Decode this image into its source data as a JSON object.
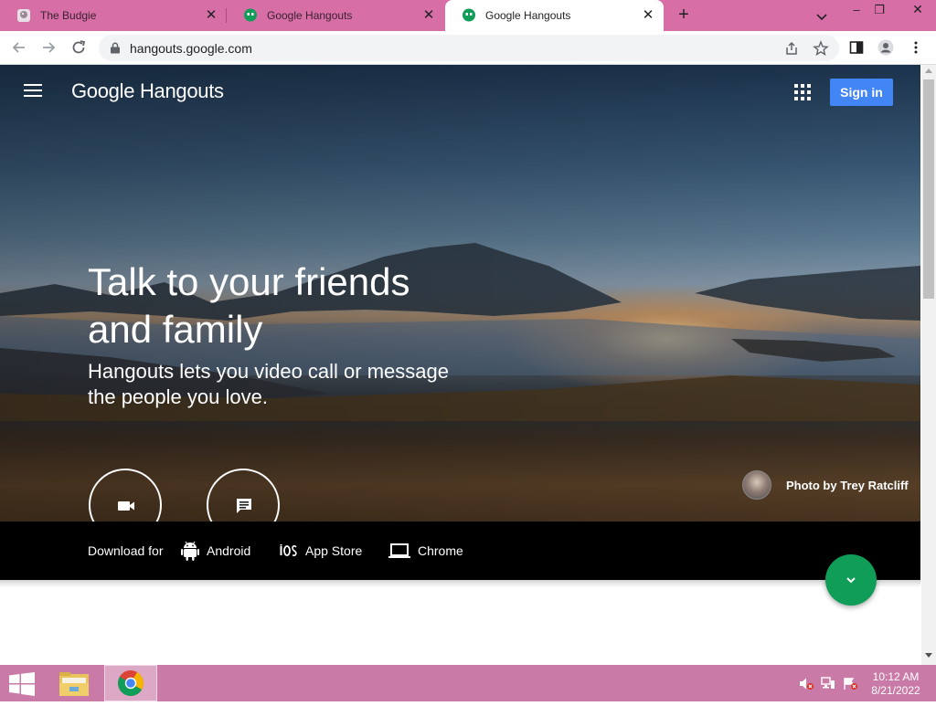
{
  "browser": {
    "tabs": [
      {
        "title": "The Budgie",
        "active": false
      },
      {
        "title": "Google Hangouts",
        "active": false
      },
      {
        "title": "Google Hangouts",
        "active": true
      }
    ],
    "url": "hangouts.google.com"
  },
  "header": {
    "brand": "Google Hangouts",
    "signin_label": "Sign in"
  },
  "hero": {
    "headline_line1": "Talk to your friends",
    "headline_line2": "and family",
    "subline_line1": "Hangouts lets you video call or message",
    "subline_line2": "the people you love.",
    "photo_credit": "Photo by Trey Ratcliff"
  },
  "download": {
    "label": "Download for",
    "items": [
      {
        "label": "Android",
        "icon": "android-icon"
      },
      {
        "label": "App Store",
        "icon": "ios-icon"
      },
      {
        "label": "Chrome",
        "icon": "laptop-icon"
      }
    ]
  },
  "taskbar": {
    "time": "10:12 AM",
    "date": "8/21/2022"
  },
  "colors": {
    "tabstrip": "#d76fa6",
    "signin": "#4285f4",
    "fab": "#0f9d58",
    "taskbar": "#c97aa6"
  }
}
